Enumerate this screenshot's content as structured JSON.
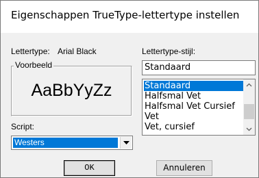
{
  "dialog": {
    "title": "Eigenschappen TrueType-lettertype instellen"
  },
  "font": {
    "label": "Lettertype:",
    "name": "Arial Black"
  },
  "preview": {
    "group_label": "Voorbeeld",
    "sample_text": "AaBbYyZz"
  },
  "script": {
    "label": "Script:",
    "selected": "Westers",
    "arrow_icon": "chevron-down-icon"
  },
  "style": {
    "label": "Lettertype-stijl:",
    "value": "Standaard",
    "items": [
      {
        "label": "Standaard",
        "selected": true
      },
      {
        "label": "Halfsmal Vet",
        "selected": false
      },
      {
        "label": "Halfsmal Vet Cursief",
        "selected": false
      },
      {
        "label": "Vet",
        "selected": false
      },
      {
        "label": "Vet, cursief",
        "selected": false
      }
    ]
  },
  "buttons": {
    "ok": "OK",
    "cancel": "Annuleren"
  },
  "colors": {
    "selection": "#0078d7",
    "dialog_bg": "#f0f0f0"
  }
}
